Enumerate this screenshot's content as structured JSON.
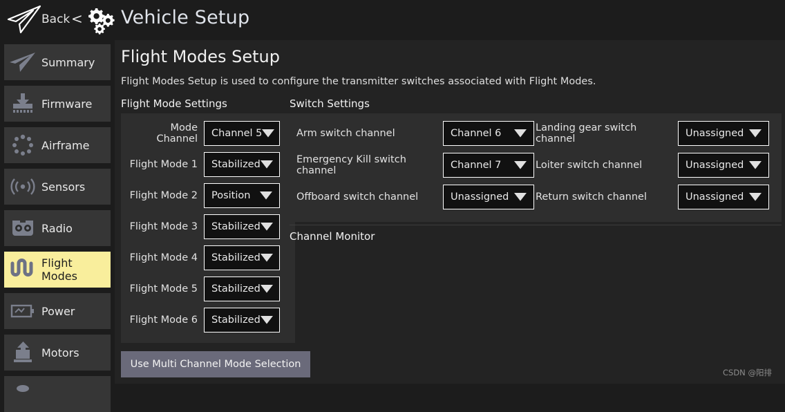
{
  "header": {
    "back_label": "Back",
    "chevron": "<",
    "title": "Vehicle Setup",
    "logo_icon": "paper-plane-icon",
    "gears_icon": "gears-icon"
  },
  "sidebar": {
    "items": [
      {
        "label": "Summary",
        "icon": "paper-plane-icon",
        "active": false
      },
      {
        "label": "Firmware",
        "icon": "firmware-download-icon",
        "active": false
      },
      {
        "label": "Airframe",
        "icon": "airframe-dots-icon",
        "active": false
      },
      {
        "label": "Sensors",
        "icon": "sensors-waves-icon",
        "active": false
      },
      {
        "label": "Radio",
        "icon": "radio-controller-icon",
        "active": false
      },
      {
        "label": "Flight Modes",
        "icon": "flight-modes-wave-icon",
        "active": true
      },
      {
        "label": "Power",
        "icon": "battery-icon",
        "active": false
      },
      {
        "label": "Motors",
        "icon": "motor-icon",
        "active": false
      }
    ]
  },
  "main": {
    "title": "Flight Modes Setup",
    "description": "Flight Modes Setup is used to configure the transmitter switches associated with Flight Modes.",
    "flight_mode_settings_label": "Flight Mode Settings",
    "switch_settings_label": "Switch Settings",
    "channel_monitor_label": "Channel Monitor",
    "multi_channel_button": "Use Multi Channel Mode Selection"
  },
  "flight_mode_settings": {
    "rows": [
      {
        "label": "Mode Channel",
        "value": "Channel 5"
      },
      {
        "label": "Flight Mode 1",
        "value": "Stabilized"
      },
      {
        "label": "Flight Mode 2",
        "value": "Position"
      },
      {
        "label": "Flight Mode 3",
        "value": "Stabilized"
      },
      {
        "label": "Flight Mode 4",
        "value": "Stabilized"
      },
      {
        "label": "Flight Mode 5",
        "value": "Stabilized"
      },
      {
        "label": "Flight Mode 6",
        "value": "Stabilized"
      }
    ]
  },
  "switch_settings": {
    "left_column": [
      {
        "label": "Arm switch channel",
        "value": "Channel 6"
      },
      {
        "label": "Emergency Kill switch channel",
        "value": "Channel 7"
      },
      {
        "label": "Offboard switch channel",
        "value": "Unassigned"
      }
    ],
    "right_column": [
      {
        "label": "Landing gear switch channel",
        "value": "Unassigned"
      },
      {
        "label": "Loiter switch channel",
        "value": "Unassigned"
      },
      {
        "label": "Return switch channel",
        "value": "Unassigned"
      }
    ]
  },
  "watermark": {
    "text": "CSDN @阳排"
  },
  "colors": {
    "app_background": "#1c1c1c",
    "main_background": "#232323",
    "panel_background": "#2e2e2e",
    "sidebar_item": "#363636",
    "sidebar_active": "#f9ee9c",
    "combo_background": "#111111",
    "combo_border": "#ffffff",
    "button_background": "#6a6a7a",
    "text_primary": "#e9e9e9"
  }
}
